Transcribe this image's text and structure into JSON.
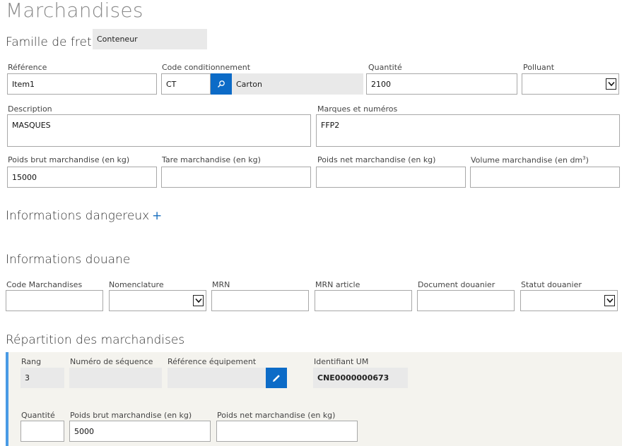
{
  "page_title": "Marchandises",
  "famille": {
    "label": "Famille de fret",
    "value": "Conteneur"
  },
  "row1": {
    "reference": {
      "label": "Référence",
      "value": "Item1"
    },
    "code_cond": {
      "label": "Code conditionnement",
      "code": "CT",
      "description": "Carton"
    },
    "quantite": {
      "label": "Quantité",
      "value": "2100"
    },
    "polluant": {
      "label": "Polluant",
      "value": ""
    }
  },
  "row2": {
    "description": {
      "label": "Description",
      "value": "MASQUES"
    },
    "marques": {
      "label": "Marques et numéros",
      "value": "FFP2"
    }
  },
  "row3": {
    "poids_brut": {
      "label": "Poids brut marchandise (en kg)",
      "value": "15000"
    },
    "tare": {
      "label": "Tare marchandise (en kg)",
      "value": ""
    },
    "poids_net": {
      "label": "Poids net marchandise (en kg)",
      "value": ""
    },
    "volume": {
      "label": "Volume marchandise (en dm",
      "sup": "3",
      "close": ")",
      "value": ""
    }
  },
  "dangereux": {
    "title": "Informations dangereux",
    "add_symbol": "+"
  },
  "douane": {
    "title": "Informations douane",
    "code_march": {
      "label": "Code Marchandises",
      "value": ""
    },
    "nomenclature": {
      "label": "Nomenclature",
      "value": ""
    },
    "mrn": {
      "label": "MRN",
      "value": ""
    },
    "mrn_article": {
      "label": "MRN article",
      "value": ""
    },
    "document": {
      "label": "Document douanier",
      "value": ""
    },
    "statut": {
      "label": "Statut douanier",
      "value": ""
    }
  },
  "repartition": {
    "title": "Répartition des marchandises",
    "rang": {
      "label": "Rang",
      "value": "3"
    },
    "sequence": {
      "label": "Numéro de séquence",
      "value": ""
    },
    "equipement": {
      "label": "Référence équipement",
      "value": ""
    },
    "identifiant": {
      "label": "Identifiant UM",
      "value": "CNE0000000673"
    },
    "quantite": {
      "label": "Quantité",
      "value": ""
    },
    "poids_brut": {
      "label": "Poids brut marchandise (en kg)",
      "value": "5000"
    },
    "poids_net": {
      "label": "Poids net marchandise (en kg)",
      "value": ""
    }
  },
  "icons": {
    "search": "search-icon",
    "edit": "pencil-icon",
    "dropdown": "chevron-down-icon",
    "add": "plus-icon"
  },
  "colors": {
    "accent": "#0c6bc7",
    "panel": "#f4f3ee",
    "panel_bar": "#4a9be5",
    "readonly": "#e9e9e9"
  }
}
